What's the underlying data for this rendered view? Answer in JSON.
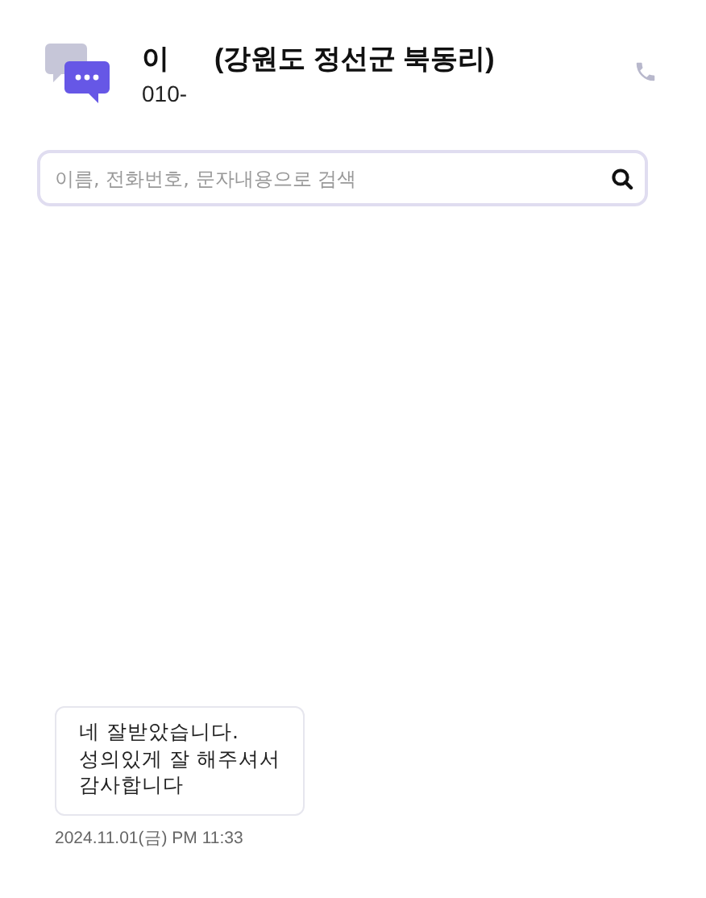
{
  "contact": {
    "name_start": "이",
    "name_rest": "(강원도 정선군 북동리)",
    "phone": "010-"
  },
  "search": {
    "placeholder": "이름, 전화번호, 문자내용으로 검색"
  },
  "messages": [
    {
      "text": "네 잘받았습니다.\n성의있게 잘 해주셔서\n감사합니다",
      "time": "2024.11.01(금) PM 11:33"
    }
  ]
}
